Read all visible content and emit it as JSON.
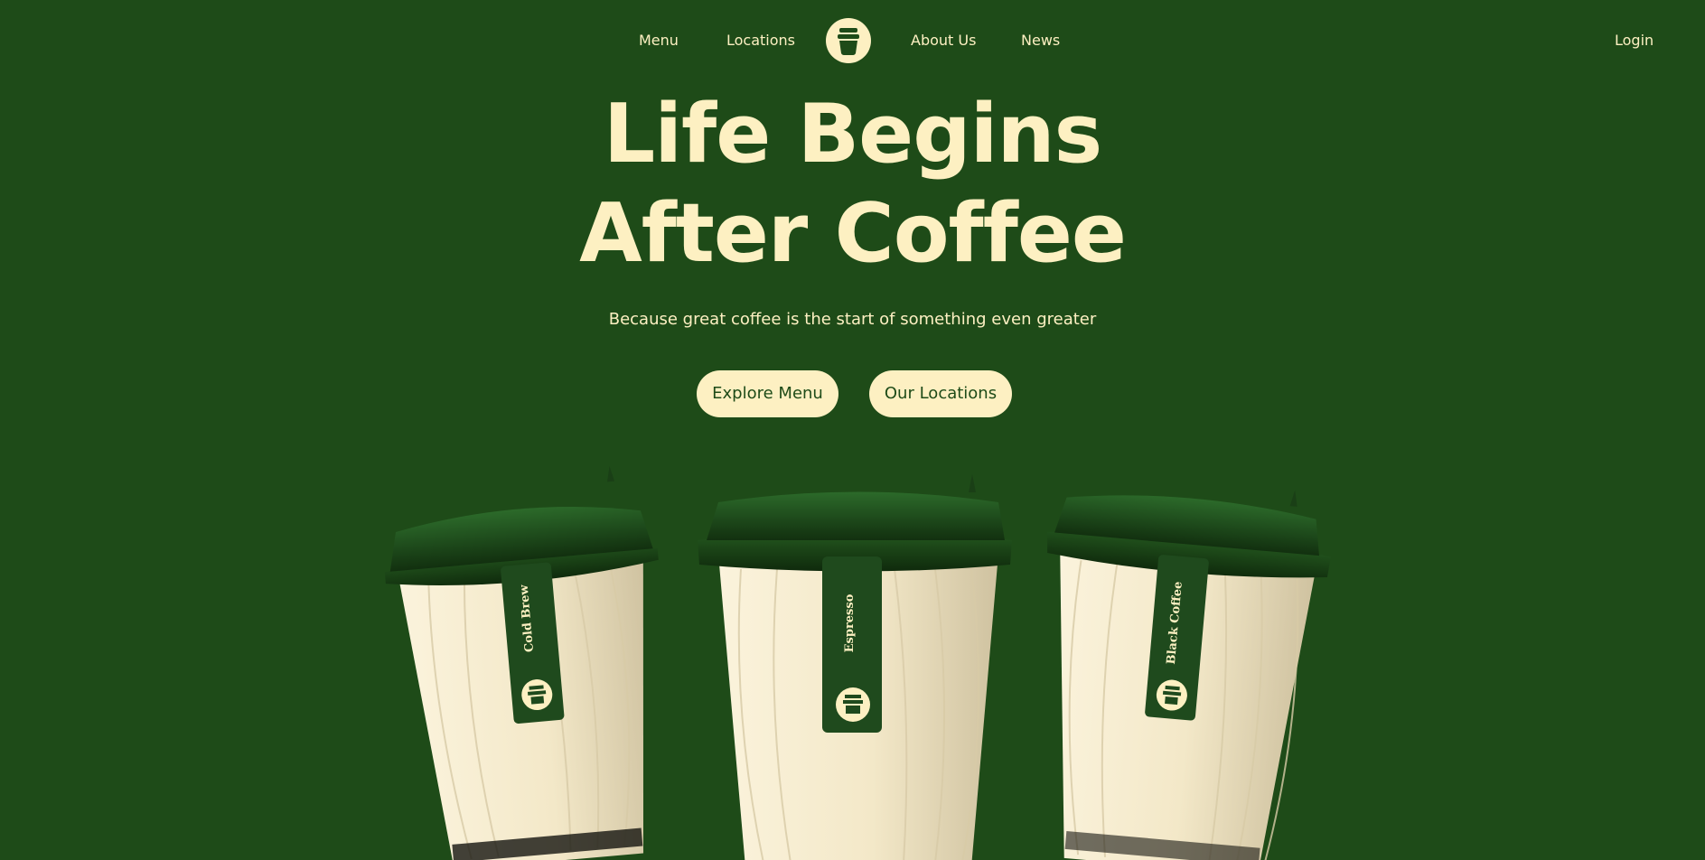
{
  "nav": {
    "menu_label": "Menu",
    "locations_label": "Locations",
    "about_label": "About Us",
    "news_label": "News",
    "login_label": "Login"
  },
  "hero": {
    "title_line1": "Life Begins",
    "title_line2": "After Coffee",
    "subtitle": "Because great coffee is the start of something even greater",
    "primary_button": "Explore Menu",
    "secondary_button": "Our Locations"
  },
  "cups": [
    {
      "label": "Cold Brew"
    },
    {
      "label": "Espresso"
    },
    {
      "label": "Black Coffee"
    }
  ],
  "colors": {
    "background": "#1e4b18",
    "cream": "#fdf0c2",
    "lid": "#1f4a1d"
  },
  "icons": {
    "logo": "coffee-cup-logo-icon"
  }
}
